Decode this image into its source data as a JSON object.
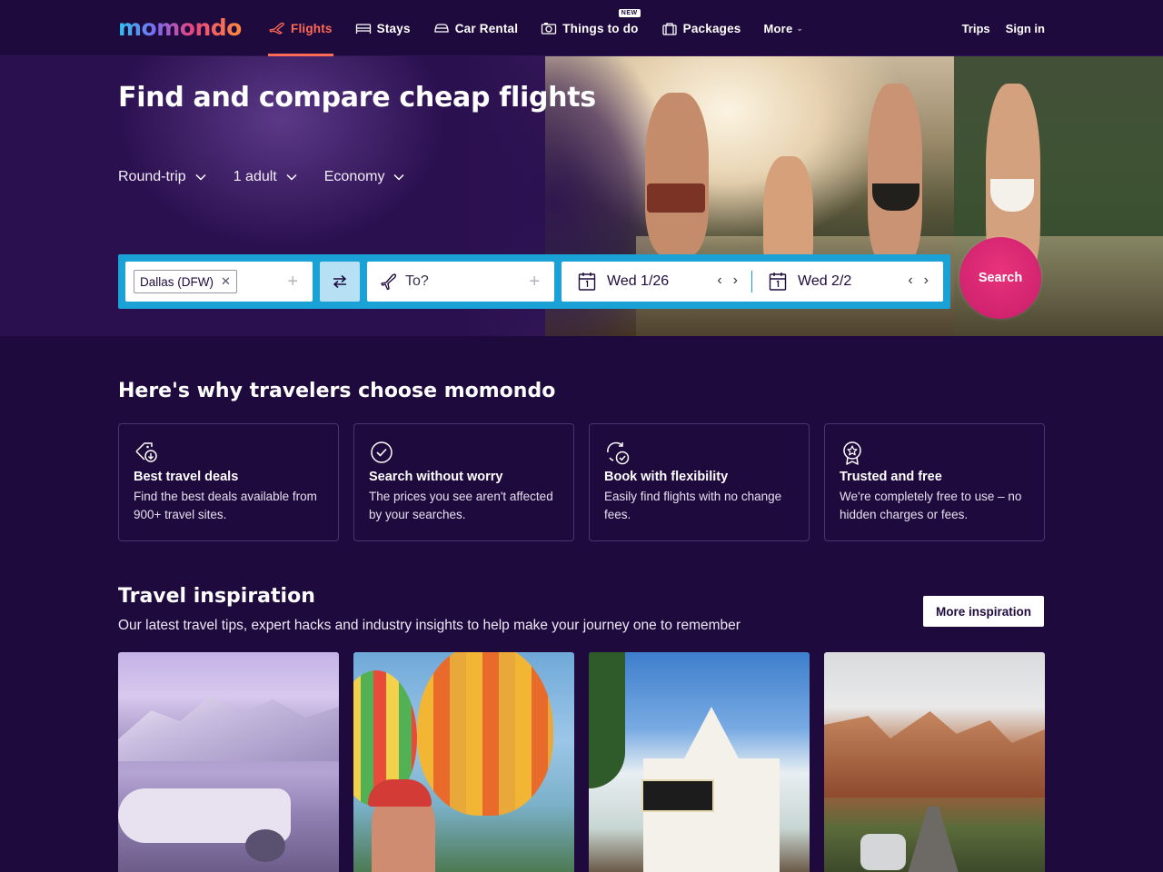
{
  "brand": {
    "logo_text": "momondo"
  },
  "nav": {
    "items": [
      {
        "label": "Flights",
        "icon": "plane-icon",
        "active": true
      },
      {
        "label": "Stays",
        "icon": "bed-icon"
      },
      {
        "label": "Car Rental",
        "icon": "car-icon"
      },
      {
        "label": "Things to do",
        "icon": "camera-icon",
        "badge": "NEW"
      },
      {
        "label": "Packages",
        "icon": "suitcase-icon"
      }
    ],
    "more_label": "More",
    "trips_label": "Trips",
    "signin_label": "Sign in"
  },
  "hero": {
    "title": "Find and compare cheap flights",
    "trip_type": "Round-trip",
    "travelers": "1 adult",
    "cabin": "Economy"
  },
  "search": {
    "origin_chip": "Dallas (DFW)",
    "destination_placeholder": "To?",
    "depart_date": "Wed 1/26",
    "return_date": "Wed 2/2",
    "button_label": "Search"
  },
  "why": {
    "title": "Here's why travelers choose momondo",
    "cards": [
      {
        "icon": "deal-tag-icon",
        "title": "Best travel deals",
        "text": "Find the best deals available from 900+ travel sites."
      },
      {
        "icon": "check-circle-icon",
        "title": "Search without worry",
        "text": "The prices you see aren't affected by your searches."
      },
      {
        "icon": "refresh-check-icon",
        "title": "Book with flexibility",
        "text": "Easily find flights with no change fees."
      },
      {
        "icon": "award-ribbon-icon",
        "title": "Trusted and free",
        "text": "We're completely free to use – no hidden charges or fees."
      }
    ]
  },
  "inspiration": {
    "title": "Travel inspiration",
    "subtitle": "Our latest travel tips, expert hacks and industry insights to help make your journey one to remember",
    "more_button": "More inspiration"
  },
  "colors": {
    "background": "#1f0a3d",
    "accent_active": "#ff6a56",
    "search_bar": "#1aa2d6",
    "search_button": "#d8226f"
  }
}
